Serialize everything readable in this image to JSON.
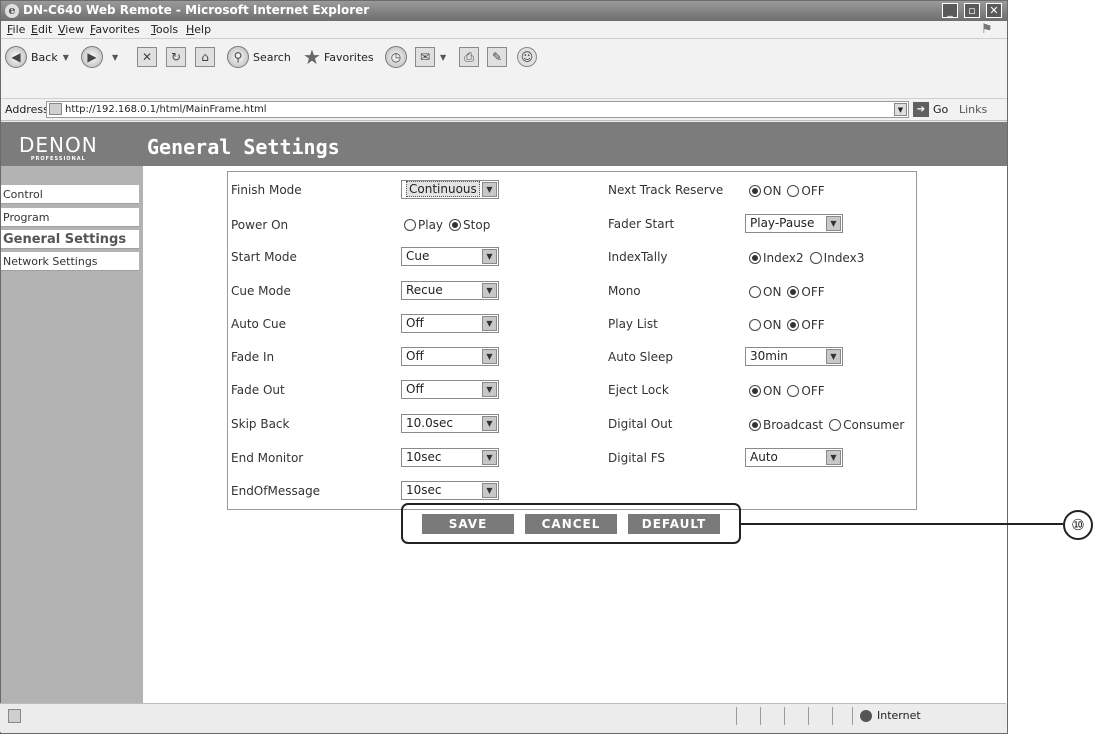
{
  "window": {
    "title": "DN-C640 Web Remote - Microsoft Internet Explorer"
  },
  "menubar": [
    "File",
    "Edit",
    "View",
    "Favorites",
    "Tools",
    "Help"
  ],
  "toolbar": {
    "back": "Back",
    "search": "Search",
    "favorites": "Favorites"
  },
  "address": {
    "label": "Address",
    "url": "http://192.168.0.1/html/MainFrame.html",
    "go": "Go",
    "links": "Links"
  },
  "page": {
    "brand": "DENON",
    "brand_sub": "PROFESSIONAL",
    "title": "General Settings"
  },
  "nav": [
    {
      "label": "Control",
      "active": false
    },
    {
      "label": "Program",
      "active": false
    },
    {
      "label": "General Settings",
      "active": true
    },
    {
      "label": "Network Settings",
      "active": false
    }
  ],
  "settings_left": [
    {
      "label": "Finish Mode",
      "value": "Continuous",
      "focused": true
    },
    {
      "label": "Power On",
      "radio": [
        "Play",
        "Stop"
      ],
      "selected": "Stop"
    },
    {
      "label": "Start Mode",
      "value": "Cue"
    },
    {
      "label": "Cue Mode",
      "value": "Recue"
    },
    {
      "label": "Auto Cue",
      "value": "Off"
    },
    {
      "label": "Fade In",
      "value": "Off"
    },
    {
      "label": "Fade Out",
      "value": "Off"
    },
    {
      "label": "Skip Back",
      "value": "10.0sec"
    },
    {
      "label": "End Monitor",
      "value": "10sec"
    },
    {
      "label": "EndOfMessage",
      "value": "10sec"
    }
  ],
  "settings_right": [
    {
      "label": "Next Track Reserve",
      "radio": [
        "ON",
        "OFF"
      ],
      "selected": "ON"
    },
    {
      "label": "Fader Start",
      "value": "Play-Pause"
    },
    {
      "label": "IndexTally",
      "radio": [
        "Index2",
        "Index3"
      ],
      "selected": "Index2"
    },
    {
      "label": "Mono",
      "radio": [
        "ON",
        "OFF"
      ],
      "selected": "OFF"
    },
    {
      "label": "Play List",
      "radio": [
        "ON",
        "OFF"
      ],
      "selected": "OFF"
    },
    {
      "label": "Auto Sleep",
      "value": "30min"
    },
    {
      "label": "Eject Lock",
      "radio": [
        "ON",
        "OFF"
      ],
      "selected": "ON"
    },
    {
      "label": "Digital Out",
      "radio": [
        "Broadcast",
        "Consumer"
      ],
      "selected": "Broadcast"
    },
    {
      "label": "Digital FS",
      "value": "Auto"
    }
  ],
  "buttons": {
    "save": "SAVE",
    "cancel": "CANCEL",
    "default": "DEFAULT"
  },
  "statusbar": {
    "zone": "Internet"
  },
  "callout": {
    "number": "⑩"
  }
}
